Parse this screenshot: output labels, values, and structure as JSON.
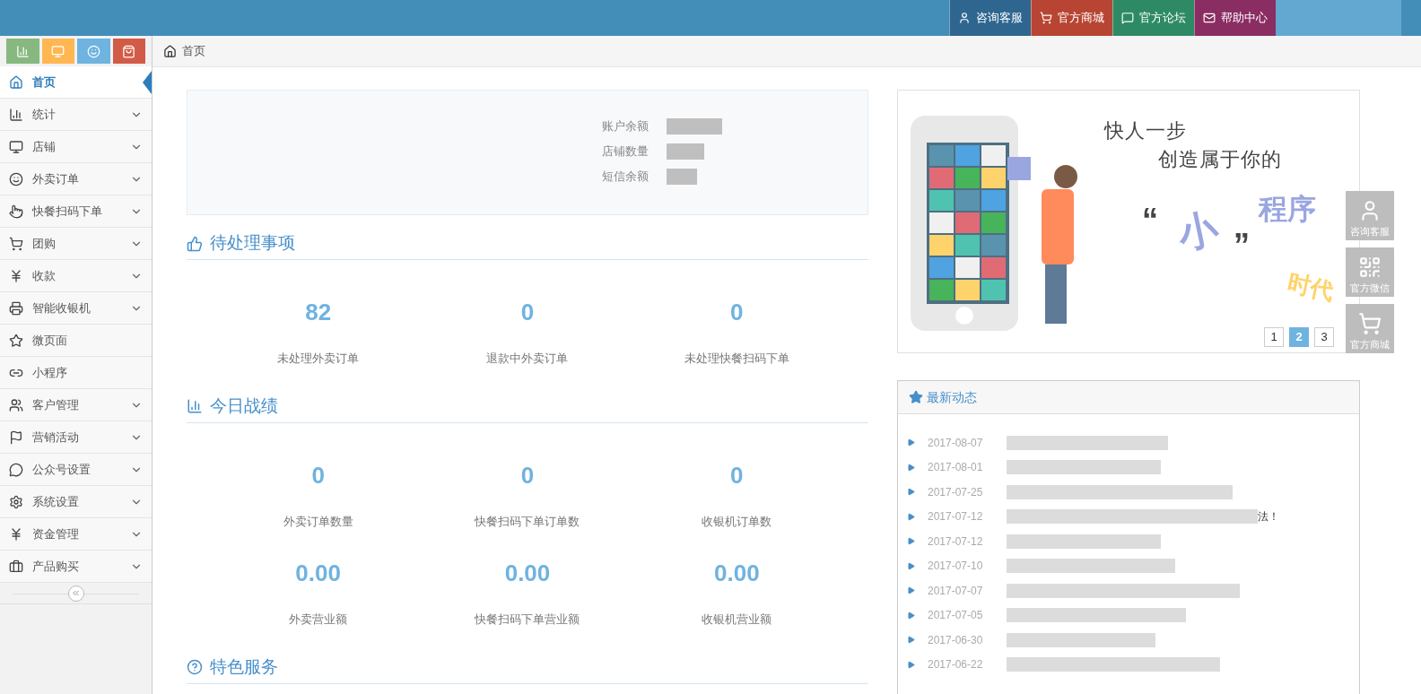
{
  "top_links": [
    {
      "label": "咨询客服",
      "color": "#2f6690"
    },
    {
      "label": "官方商城",
      "color": "#b84533"
    },
    {
      "label": "官方论坛",
      "color": "#2e8a65"
    },
    {
      "label": "帮助中心",
      "color": "#8a2d62"
    }
  ],
  "shortcuts": [
    {
      "color": "#87b87f"
    },
    {
      "color": "#ffb752"
    },
    {
      "color": "#6fb3e0"
    },
    {
      "color": "#d15b47"
    }
  ],
  "breadcrumb": "首页",
  "sidebar": {
    "items": [
      {
        "label": "首页",
        "selected": true,
        "expandable": false
      },
      {
        "label": "统计",
        "selected": false,
        "expandable": true
      },
      {
        "label": "店铺",
        "selected": false,
        "expandable": true
      },
      {
        "label": "外卖订单",
        "selected": false,
        "expandable": true
      },
      {
        "label": "快餐扫码下单",
        "selected": false,
        "expandable": true
      },
      {
        "label": "团购",
        "selected": false,
        "expandable": true
      },
      {
        "label": "收款",
        "selected": false,
        "expandable": true
      },
      {
        "label": "智能收银机",
        "selected": false,
        "expandable": true
      },
      {
        "label": "微页面",
        "selected": false,
        "expandable": false
      },
      {
        "label": "小程序",
        "selected": false,
        "expandable": false
      },
      {
        "label": "客户管理",
        "selected": false,
        "expandable": true
      },
      {
        "label": "营销活动",
        "selected": false,
        "expandable": true
      },
      {
        "label": "公众号设置",
        "selected": false,
        "expandable": true
      },
      {
        "label": "系统设置",
        "selected": false,
        "expandable": true
      },
      {
        "label": "资金管理",
        "selected": false,
        "expandable": true
      },
      {
        "label": "产品购买",
        "selected": false,
        "expandable": true
      }
    ]
  },
  "account": {
    "fields": [
      {
        "label": "账户余额"
      },
      {
        "label": "店铺数量"
      },
      {
        "label": "短信余额"
      }
    ]
  },
  "sections": [
    {
      "title": "待处理事项",
      "stats": [
        {
          "value": "82",
          "label": "未处理外卖订单"
        },
        {
          "value": "0",
          "label": "退款中外卖订单"
        },
        {
          "value": "0",
          "label": "未处理快餐扫码下单"
        }
      ]
    },
    {
      "title": "今日战绩",
      "stats": [
        {
          "value": "0",
          "label": "外卖订单数量"
        },
        {
          "value": "0",
          "label": "快餐扫码下单订单数"
        },
        {
          "value": "0",
          "label": "收银机订单数"
        },
        {
          "value": "0.00",
          "label": "外卖营业额"
        },
        {
          "value": "0.00",
          "label": "快餐扫码下单营业额"
        },
        {
          "value": "0.00",
          "label": "收银机营业额"
        }
      ]
    },
    {
      "title": "特色服务"
    }
  ],
  "banner": {
    "line_1": "快人一步",
    "line_2": "创造属于你的",
    "open_quote": "“",
    "word_small": "小",
    "close_quote": "”",
    "word_program": "程序",
    "word_era": "时代",
    "pages": [
      {
        "label": "1",
        "selected": false
      },
      {
        "label": "2",
        "selected": true
      },
      {
        "label": "3",
        "selected": false
      }
    ]
  },
  "news": {
    "title": "最新动态",
    "items": [
      {
        "date": "2017-08-07"
      },
      {
        "date": "2017-08-01"
      },
      {
        "date": "2017-07-25"
      },
      {
        "date": "2017-07-12",
        "tail": "法！"
      },
      {
        "date": "2017-07-12"
      },
      {
        "date": "2017-07-10"
      },
      {
        "date": "2017-07-07"
      },
      {
        "date": "2017-07-05"
      },
      {
        "date": "2017-06-30"
      },
      {
        "date": "2017-06-22"
      }
    ]
  },
  "float_buttons": [
    {
      "label": "咨询客服"
    },
    {
      "label": "官方微信"
    },
    {
      "label": "官方商城"
    }
  ]
}
